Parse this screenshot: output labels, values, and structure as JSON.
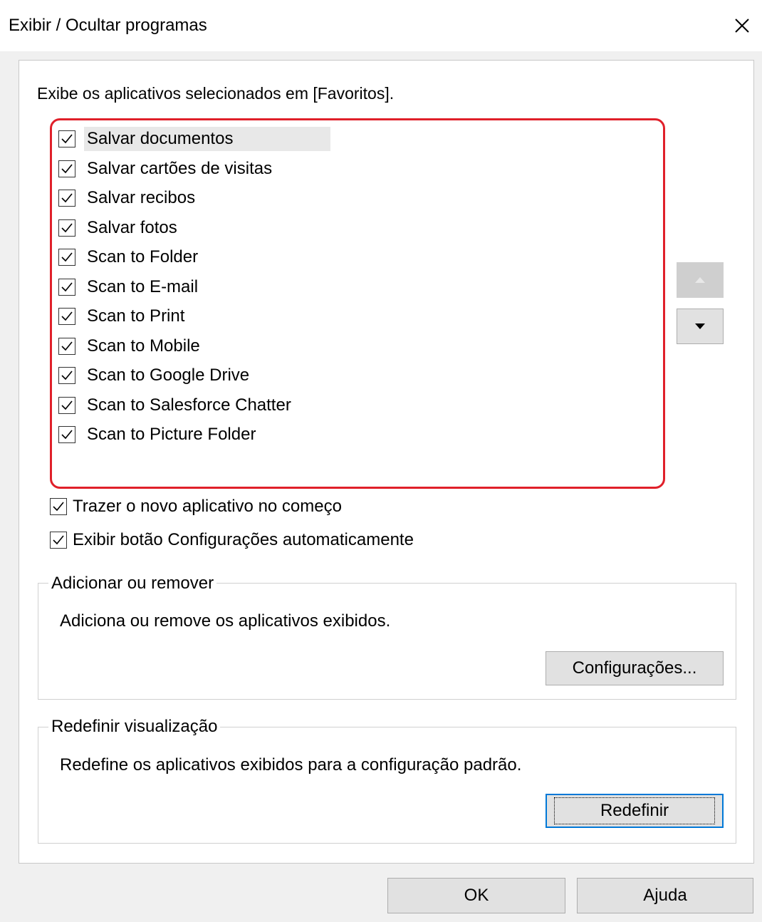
{
  "window": {
    "title": "Exibir / Ocultar programas"
  },
  "intro": "Exibe os aplicativos selecionados em [Favoritos].",
  "apps": [
    {
      "label": "Salvar documentos",
      "checked": true,
      "selected": true
    },
    {
      "label": "Salvar cartões de visitas",
      "checked": true
    },
    {
      "label": "Salvar recibos",
      "checked": true
    },
    {
      "label": "Salvar fotos",
      "checked": true
    },
    {
      "label": "Scan to Folder",
      "checked": true
    },
    {
      "label": "Scan to E-mail",
      "checked": true
    },
    {
      "label": "Scan to Print",
      "checked": true
    },
    {
      "label": "Scan to Mobile",
      "checked": true
    },
    {
      "label": "Scan to Google Drive",
      "checked": true
    },
    {
      "label": "Scan to Salesforce Chatter",
      "checked": true
    },
    {
      "label": "Scan to Picture Folder",
      "checked": true
    }
  ],
  "options": {
    "bring_new_first": {
      "label": "Trazer o novo aplicativo no começo",
      "checked": true
    },
    "show_settings_auto": {
      "label": "Exibir botão Configurações automaticamente",
      "checked": true
    }
  },
  "add_remove": {
    "title": "Adicionar ou remover",
    "description": "Adiciona ou remove os aplicativos exibidos.",
    "button": "Configurações..."
  },
  "reset": {
    "title": "Redefinir visualização",
    "description": "Redefine os aplicativos exibidos para a configuração padrão.",
    "button": "Redefinir"
  },
  "footer": {
    "ok": "OK",
    "help": "Ajuda"
  },
  "colors": {
    "highlight_border": "#e0202a",
    "focus_border": "#0078d7"
  }
}
